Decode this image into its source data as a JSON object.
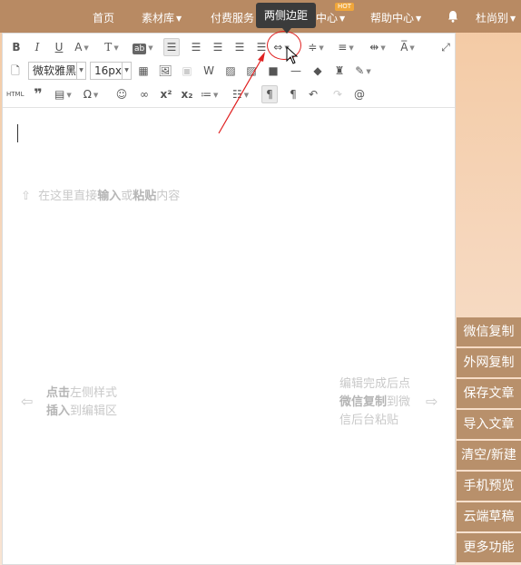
{
  "topnav": {
    "items": [
      {
        "label": "首页",
        "has_dropdown": false
      },
      {
        "label": "素材库",
        "has_dropdown": true
      },
      {
        "label": "付费服务",
        "has_dropdown": false
      },
      {
        "label": "中心",
        "has_dropdown": true
      },
      {
        "label": "帮助中心",
        "has_dropdown": true
      }
    ],
    "hot_badge": "HOT",
    "bell_icon": "bell-icon",
    "user_name": "杜尚别",
    "tooltip": "两侧边距"
  },
  "toolbar": {
    "font_family": "微软雅黑",
    "font_size": "16px",
    "html_label": "HTML"
  },
  "editor": {
    "hint_top": {
      "pre": "在这里直接",
      "b1": "输入",
      "mid": "或",
      "b2": "粘贴",
      "post": "内容"
    },
    "hint_left": {
      "b1": "点击",
      "t1": "左侧样式",
      "b2": "插入",
      "t2": "到编辑区"
    },
    "hint_right": {
      "l1": "编辑完成后点",
      "b1": "微信复制",
      "t1": "到微",
      "l3": "信后台粘贴"
    }
  },
  "side_buttons": [
    "微信复制",
    "外网复制",
    "保存文章",
    "导入文章",
    "清空/新建",
    "手机预览",
    "云端草稿",
    "更多功能"
  ],
  "colors": {
    "nav_bg": "#b88a63",
    "side_btn_bg": "#b8906b",
    "hot_badge": "#f0a63a",
    "annotation_red": "#e02020"
  }
}
